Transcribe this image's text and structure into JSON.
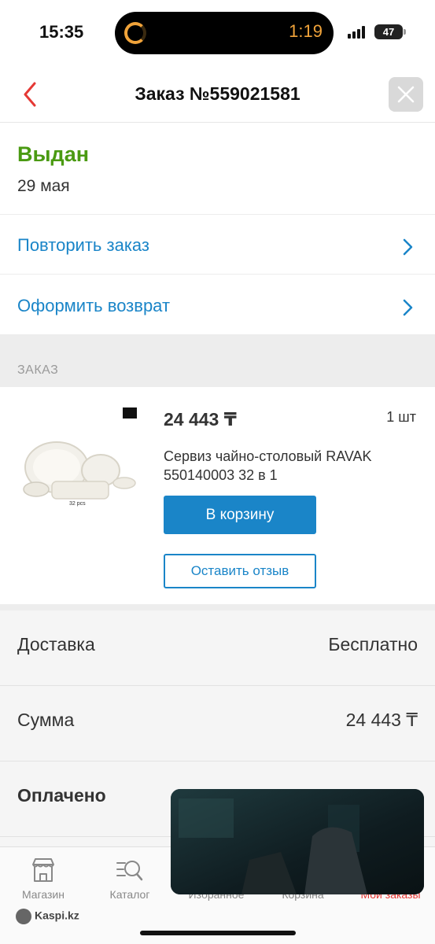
{
  "status_bar": {
    "time": "15:35",
    "island_timer": "1:19",
    "battery": "47"
  },
  "header": {
    "title": "Заказ №559021581",
    "back_icon": "chevron-left-icon",
    "close_icon": "close-icon"
  },
  "order_status": {
    "label": "Выдан",
    "date": "29 мая"
  },
  "actions": [
    {
      "label": "Повторить заказ"
    },
    {
      "label": "Оформить возврат"
    }
  ],
  "section": {
    "label": "ЗАКАЗ"
  },
  "product": {
    "price": "24 443 ₸",
    "quantity": "1 шт",
    "name": "Сервиз чайно-столовый RAVAK 550140003 32 в 1",
    "image_caption": "32 pcs",
    "cart_button": "В корзину",
    "review_button": "Оставить отзыв"
  },
  "summary": [
    {
      "label": "Доставка",
      "value": "Бесплатно"
    },
    {
      "label": "Сумма",
      "value": "24 443 ₸"
    },
    {
      "label": "Оплачено",
      "value": ""
    }
  ],
  "tabbar": {
    "brand": "Kaspi.kz",
    "items": [
      {
        "label": "Магазин",
        "icon": "store-icon"
      },
      {
        "label": "Каталог",
        "icon": "catalog-search-icon"
      },
      {
        "label": "Избранное",
        "icon": "heart-icon"
      },
      {
        "label": "Корзина",
        "icon": "cart-icon"
      },
      {
        "label": "Мои заказы",
        "icon": "orders-icon"
      }
    ]
  },
  "colors": {
    "accent": "#1a85c8",
    "status_green": "#4a9a12",
    "back_red": "#e53935"
  }
}
